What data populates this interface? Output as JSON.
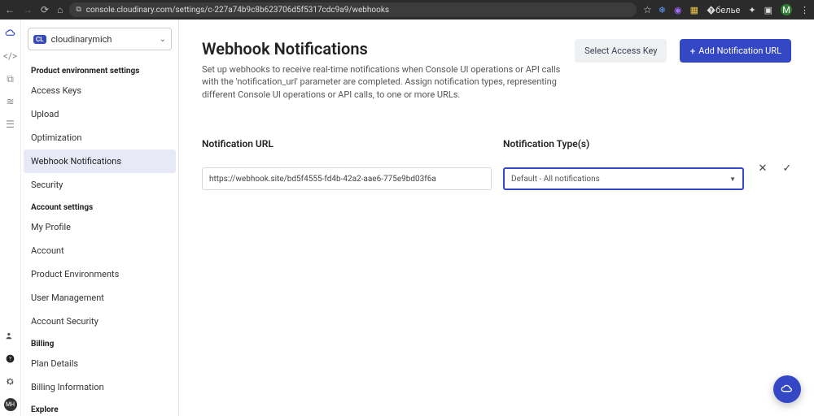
{
  "browser": {
    "url": "console.cloudinary.com/settings/c-227a74b9c8b623706d5f5317cdc9a9/webhooks",
    "avatar_letter": "M"
  },
  "account_selector": {
    "chip": "CL",
    "name": "cloudinarymich"
  },
  "sidebar": {
    "groups": [
      {
        "title": "Product environment settings",
        "items": [
          "Access Keys",
          "Upload",
          "Optimization",
          "Webhook Notifications",
          "Security"
        ],
        "active_index": 3
      },
      {
        "title": "Account settings",
        "items": [
          "My Profile",
          "Account",
          "Product Environments",
          "User Management",
          "Account Security"
        ]
      },
      {
        "title": "Billing",
        "items": [
          "Plan Details",
          "Billing Information"
        ]
      },
      {
        "title": "Explore",
        "items": []
      }
    ]
  },
  "page": {
    "title": "Webhook Notifications",
    "description": "Set up webhooks to receive real-time notifications when Console UI operations or API calls with the 'notification_url' parameter are completed. Assign notification types, representing different Console UI operations or API calls, to one or more URLs.",
    "select_access_key": "Select Access Key",
    "add_btn": "Add Notification URL",
    "col_url": "Notification URL",
    "col_type": "Notification Type(s)",
    "url_value": "https://webhook.site/bd5f4555-fd4b-42a2-aae6-775e9bd03f6a",
    "type_value": "Default - All notifications"
  },
  "rail_avatar": "MH"
}
